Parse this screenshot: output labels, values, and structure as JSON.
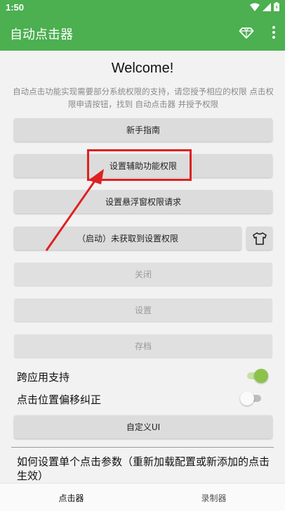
{
  "status_bar": {
    "time": "1:50"
  },
  "app_bar": {
    "title": "自动点击器"
  },
  "welcome": {
    "heading": "Welcome!",
    "description": "自动点击功能实现需要部分系统权限的支持，请您授予相应的权限 点击权限申请按钮，找到 自动点击器 并授予权限"
  },
  "buttons": {
    "guide": "新手指南",
    "accessibility": "设置辅助功能权限",
    "overlay": "设置悬浮窗权限请求",
    "start": "（启动）未获取到设置权限",
    "close": "关闭",
    "settings": "设置",
    "save": "存档",
    "custom_ui": "自定义UI"
  },
  "toggles": {
    "cross_app": {
      "label": "跨应用支持",
      "on": true
    },
    "offset_correction": {
      "label": "点击位置偏移纠正",
      "on": false
    }
  },
  "section": {
    "text": "如何设置单个点击参数（重新加载配置或新添加的点击生效）"
  },
  "bottom_nav": {
    "tabs": [
      "点击器",
      "录制器"
    ]
  },
  "colors": {
    "primary": "#4caf50",
    "highlight": "#e02020",
    "switch_on": "#8bc34a"
  }
}
